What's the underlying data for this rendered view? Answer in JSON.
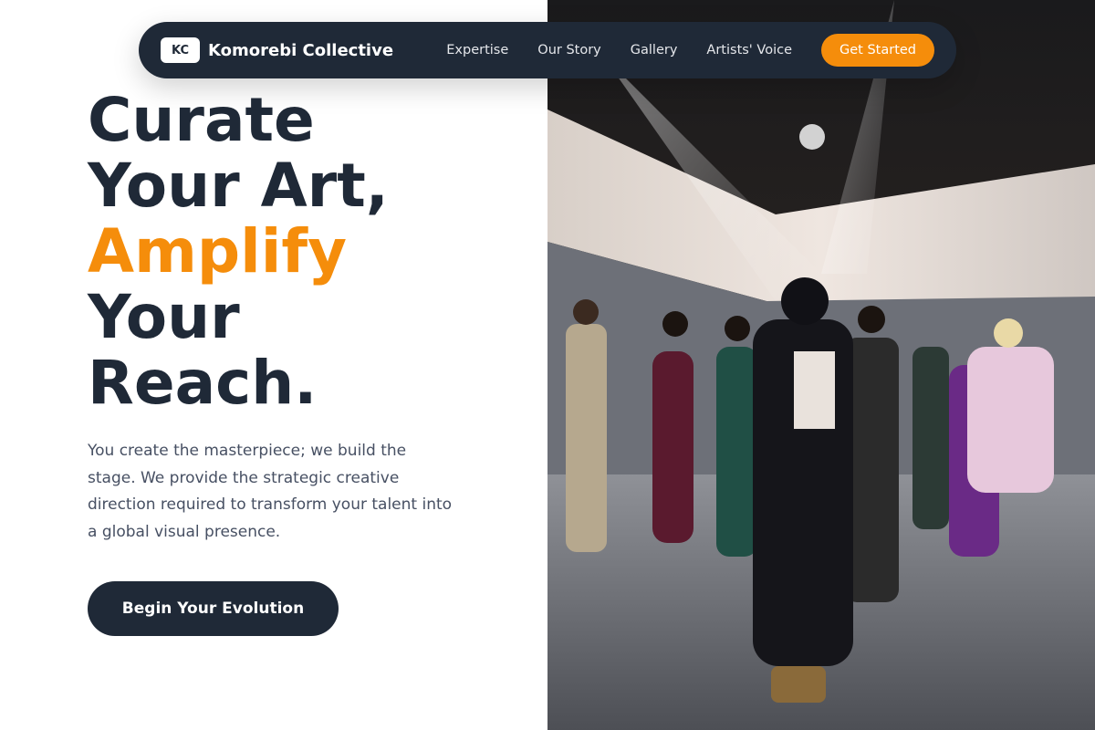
{
  "nav": {
    "logo_initials": "KC",
    "brand": "Komorebi Collective",
    "links": [
      "Expertise",
      "Our Story",
      "Gallery",
      "Artists' Voice"
    ],
    "cta": "Get Started"
  },
  "hero": {
    "headline_line1": "Curate",
    "headline_line2": "Your Art,",
    "headline_accent": "Amplify",
    "headline_line4": "Your",
    "headline_line5": "Reach.",
    "description": "You create the masterpiece; we build the stage. We provide the strategic creative direction required to transform your talent into a global visual presence.",
    "cta": "Begin Your Evolution"
  },
  "colors": {
    "primary_dark": "#1f2937",
    "accent": "#f58d0b",
    "body_text": "#475063"
  }
}
